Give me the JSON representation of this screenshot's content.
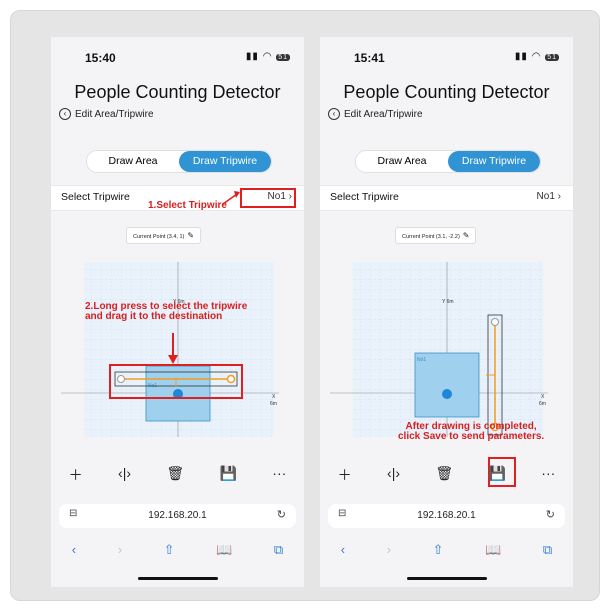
{
  "phones": [
    {
      "time": "15:40",
      "battery": "51",
      "title": "People Counting Detector",
      "back_label": "Edit Area/Tripwire",
      "tabs": [
        "Draw Area",
        "Draw Tripwire"
      ],
      "active_tab": 1,
      "select_label": "Select Tripwire",
      "select_value": "No1",
      "current_point": "Current Point  (3.4,   1)",
      "y_axis": "Y 6m",
      "x_axis": [
        "X",
        "6m"
      ],
      "area_label": "No1",
      "url": "192.168.20.1",
      "annot_select": "1.Select Tripwire",
      "annot_press_1": "2.Long press to select the tripwire",
      "annot_press_2": "and drag it to the destination"
    },
    {
      "time": "15:41",
      "battery": "51",
      "title": "People Counting Detector",
      "back_label": "Edit Area/Tripwire",
      "tabs": [
        "Draw Area",
        "Draw Tripwire"
      ],
      "active_tab": 1,
      "select_label": "Select Tripwire",
      "select_value": "No1",
      "current_point": "Current Point  (3.1,   -2.2)",
      "y_axis": "Y 6m",
      "x_axis": [
        "X",
        "6m"
      ],
      "area_label": "No1",
      "url": "192.168.20.1",
      "annot_save_1": "After drawing is completed,",
      "annot_save_2": "click Save to send parameters."
    }
  ],
  "icons": {
    "add": "plus-icon",
    "flip": "flip-icon",
    "delete": "trash-icon",
    "save": "save-icon",
    "more": "more-icon"
  },
  "colors": {
    "accent": "#2f93d4",
    "annotation": "#e02020",
    "tripwire": "#f39a1e"
  }
}
